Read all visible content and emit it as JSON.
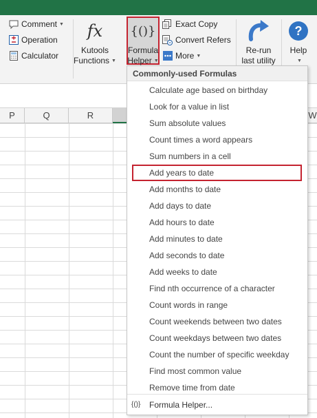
{
  "ribbon": {
    "comment_label": "Comment",
    "operation_label": "Operation",
    "calculator_label": "Calculator",
    "kutools_functions": {
      "icon_text": "fx",
      "line1": "Kutools",
      "line2": "Functions"
    },
    "formula_helper": {
      "icon_text": "{()}",
      "line1": "Formula",
      "line2": "Helper"
    },
    "exact_copy_label": "Exact Copy",
    "convert_refers_label": "Convert Refers",
    "more_label": "More",
    "rerun": {
      "line1": "Re-run",
      "line2": "last utility"
    },
    "help_label": "Help"
  },
  "columns": [
    "P",
    "Q",
    "R",
    "",
    "W"
  ],
  "menu": {
    "header": "Commonly-used Formulas",
    "items": [
      "Calculate age based on birthday",
      "Look for a value in list",
      "Sum absolute values",
      "Count times a word appears",
      "Sum numbers in a cell",
      "Add years to date",
      "Add months to date",
      "Add days to date",
      "Add hours to date",
      "Add minutes to date",
      "Add seconds to date",
      "Add weeks to date",
      "Find nth occurrence of a character",
      "Count words in range",
      "Count weekends between two dates",
      "Count weekdays between two dates",
      "Count the number of specific weekday",
      "Find most common value",
      "Remove time from date"
    ],
    "highlighted_index": 5,
    "footer_icon": "{()}",
    "footer_label": "Formula Helper..."
  },
  "colors": {
    "excel_green": "#217346",
    "highlight_red": "#c4222f",
    "rerun_blue": "#3b79c9",
    "help_blue": "#2f73c3"
  }
}
